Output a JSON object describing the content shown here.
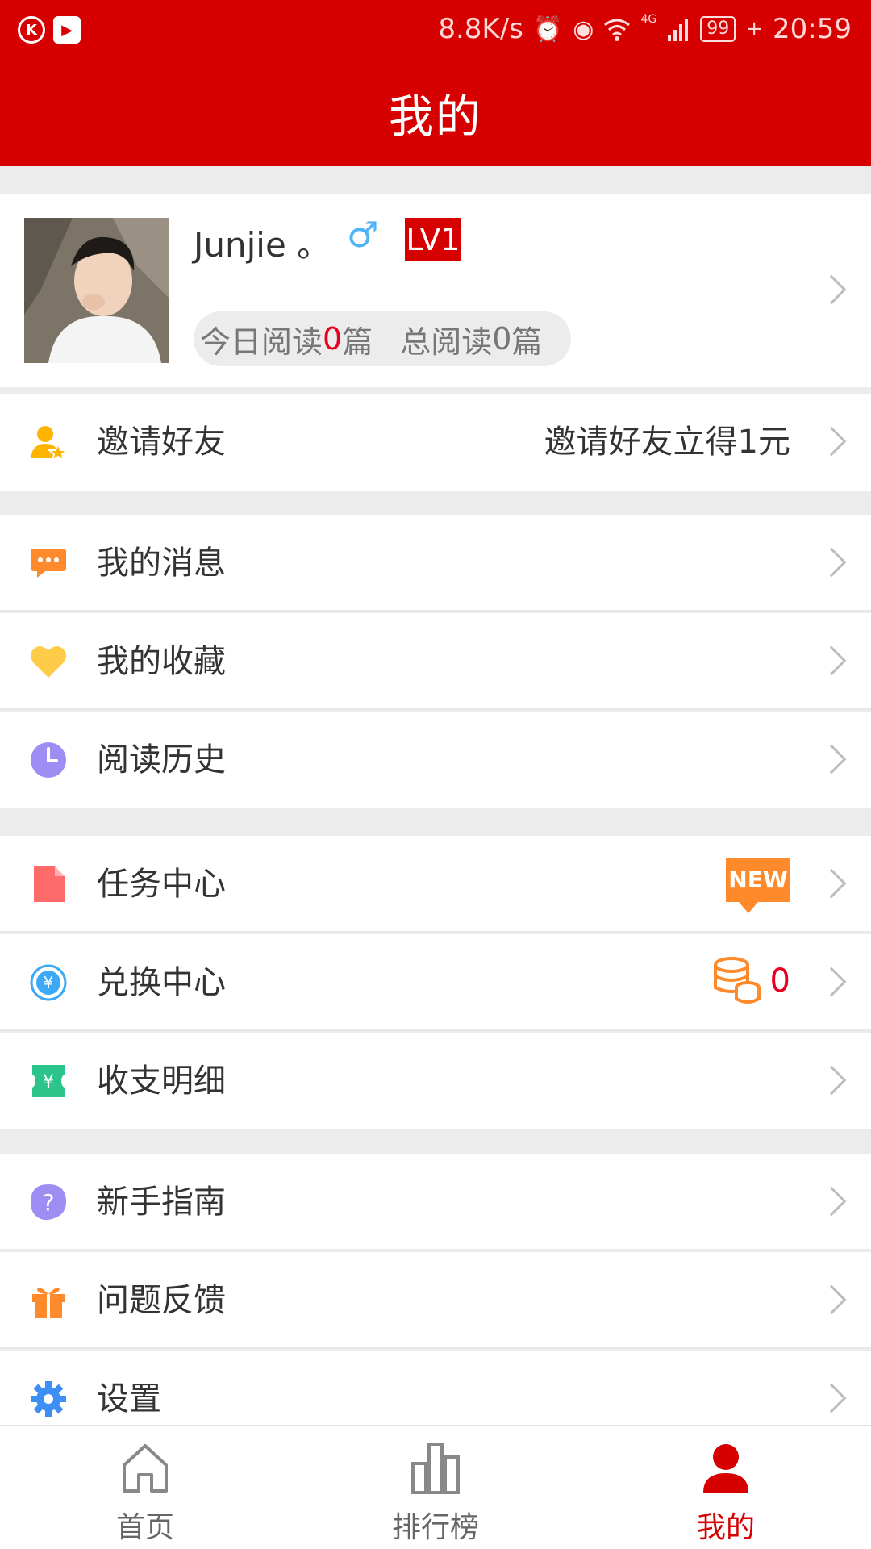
{
  "status_bar": {
    "speed": "8.8K/s",
    "network": "4G",
    "battery": "99",
    "time": "20:59"
  },
  "header": {
    "title": "我的"
  },
  "profile": {
    "username": "Junjie 。",
    "gender_symbol": "♂",
    "level": "LV1",
    "stats": {
      "today_prefix": "今日阅读",
      "today_count": "0",
      "today_suffix": "篇",
      "total_prefix": "总阅读",
      "total_count": "0",
      "total_suffix": "篇"
    }
  },
  "menu": {
    "invite": {
      "label": "邀请好友",
      "right_text": "邀请好友立得1元",
      "icon": "user-star-icon"
    },
    "messages": {
      "label": "我的消息",
      "icon": "chat-bubble-icon"
    },
    "favorites": {
      "label": "我的收藏",
      "icon": "heart-icon"
    },
    "history": {
      "label": "阅读历史",
      "icon": "clock-icon"
    },
    "tasks": {
      "label": "任务中心",
      "badge": "NEW",
      "icon": "document-icon"
    },
    "exchange": {
      "label": "兑换中心",
      "coin_count": "0",
      "icon": "yuan-exchange-icon"
    },
    "ledger": {
      "label": "收支明细",
      "icon": "yuan-note-icon"
    },
    "guide": {
      "label": "新手指南",
      "icon": "question-icon"
    },
    "feedback": {
      "label": "问题反馈",
      "icon": "gift-icon"
    },
    "settings": {
      "label": "设置",
      "icon": "gear-icon"
    }
  },
  "bottom_nav": [
    {
      "label": "首页",
      "icon": "home-icon",
      "active": false
    },
    {
      "label": "排行榜",
      "icon": "ranking-icon",
      "active": false
    },
    {
      "label": "我的",
      "icon": "person-icon",
      "active": true
    }
  ],
  "colors": {
    "brand": "#d60000",
    "accent_red": "#e8001e",
    "badge_orange": "#ff8a2b"
  }
}
